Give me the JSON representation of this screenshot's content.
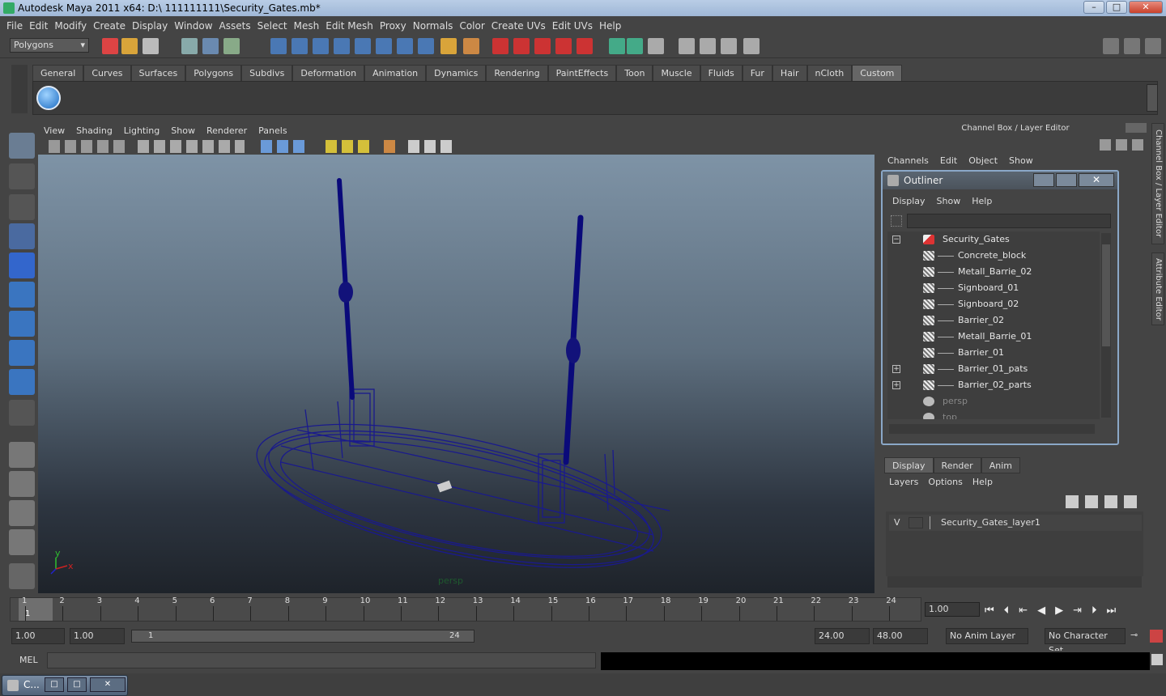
{
  "window": {
    "title": "Autodesk Maya 2011 x64: D:\\ 111111111\\Security_Gates.mb*",
    "min": "–",
    "max": "□",
    "close": "✕"
  },
  "menubar": [
    "File",
    "Edit",
    "Modify",
    "Create",
    "Display",
    "Window",
    "Assets",
    "Select",
    "Mesh",
    "Edit Mesh",
    "Proxy",
    "Normals",
    "Color",
    "Create UVs",
    "Edit UVs",
    "Help"
  ],
  "statusline": {
    "mode": "Polygons"
  },
  "shelf": {
    "tabs": [
      "General",
      "Curves",
      "Surfaces",
      "Polygons",
      "Subdivs",
      "Deformation",
      "Animation",
      "Dynamics",
      "Rendering",
      "PaintEffects",
      "Toon",
      "Muscle",
      "Fluids",
      "Fur",
      "Hair",
      "nCloth",
      "Custom"
    ],
    "active_tab": "Custom"
  },
  "viewport": {
    "menu": [
      "View",
      "Shading",
      "Lighting",
      "Show",
      "Renderer",
      "Panels"
    ],
    "camera_label": "persp",
    "axis_y": "y",
    "axis_x": "x",
    "wire_color": "#1a1a8c"
  },
  "channelbox": {
    "title": "Channel Box / Layer Editor",
    "menu": [
      "Channels",
      "Edit",
      "Object",
      "Show"
    ]
  },
  "outliner": {
    "title": "Outliner",
    "menu": [
      "Display",
      "Show",
      "Help"
    ],
    "items": [
      {
        "label": "Security_Gates",
        "expand": "−"
      },
      {
        "label": "Concrete_block"
      },
      {
        "label": "Metall_Barrie_02"
      },
      {
        "label": "Signboard_01"
      },
      {
        "label": "Signboard_02"
      },
      {
        "label": "Barrier_02"
      },
      {
        "label": "Metall_Barrie_01"
      },
      {
        "label": "Barrier_01"
      },
      {
        "label": "Barrier_01_pats",
        "expand": "+"
      },
      {
        "label": "Barrier_02_parts",
        "expand": "+"
      },
      {
        "label": "persp"
      },
      {
        "label": "top"
      }
    ]
  },
  "layers": {
    "tabs": [
      "Display",
      "Render",
      "Anim"
    ],
    "active_tab": "Display",
    "menu": [
      "Layers",
      "Options",
      "Help"
    ],
    "row": {
      "visible": "V",
      "name": "Security_Gates_layer1"
    }
  },
  "sidetabs": [
    "Channel Box / Layer Editor",
    "Attribute Editor"
  ],
  "timeline": {
    "ticks": [
      "1",
      "2",
      "3",
      "4",
      "5",
      "6",
      "7",
      "8",
      "9",
      "10",
      "11",
      "12",
      "13",
      "14",
      "15",
      "16",
      "17",
      "18",
      "19",
      "20",
      "21",
      "22",
      "23",
      "24"
    ],
    "current_frame": "1.00",
    "current_marker": "1"
  },
  "range": {
    "start": "1.00",
    "min": "1.00",
    "slider_start": "1",
    "slider_end": "24",
    "max": "24.00",
    "end": "48.00",
    "anim_layer": "No Anim Layer",
    "character_set": "No Character Set"
  },
  "cmd": {
    "label": "MEL"
  },
  "taskbar": {
    "label": "C..."
  }
}
